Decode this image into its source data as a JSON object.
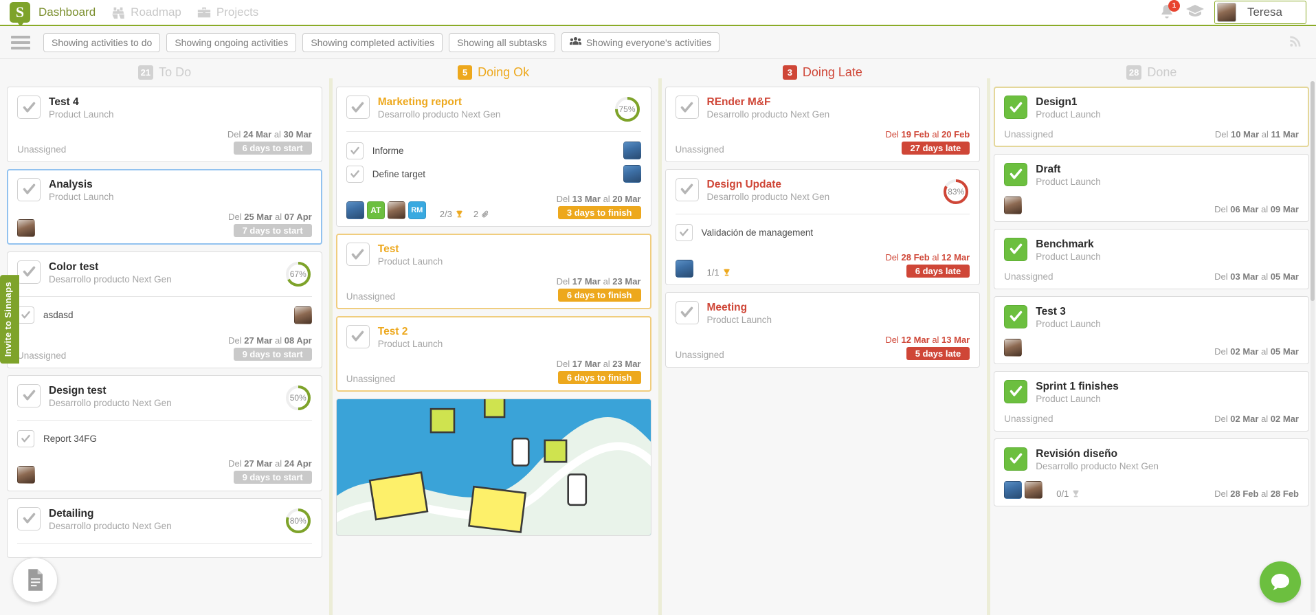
{
  "nav": {
    "logo_letter": "S",
    "items": [
      {
        "label": "Dashboard",
        "icon": "",
        "active": true
      },
      {
        "label": "Roadmap",
        "icon": "binoculars-icon",
        "active": false
      },
      {
        "label": "Projects",
        "icon": "briefcase-icon",
        "active": false
      }
    ],
    "notification_count": "1",
    "user_name": "Teresa"
  },
  "filters": {
    "chips": [
      {
        "label": "Showing activities to do",
        "icon": ""
      },
      {
        "label": "Showing ongoing activities",
        "icon": ""
      },
      {
        "label": "Showing completed activities",
        "icon": ""
      },
      {
        "label": "Showing all subtasks",
        "icon": ""
      },
      {
        "label": "Showing everyone's activities",
        "icon": "people-icon"
      }
    ]
  },
  "invite_tab": "Invite to Sinnaps",
  "columns": {
    "todo": {
      "count": "21",
      "title": "To Do"
    },
    "ok": {
      "count": "5",
      "title": "Doing Ok"
    },
    "late": {
      "count": "3",
      "title": "Doing Late"
    },
    "done": {
      "count": "28",
      "title": "Done"
    }
  },
  "todo_cards": [
    {
      "title": "Test 4",
      "project": "Product Launch",
      "assignee": "Unassigned",
      "daterange_prefix": "Del ",
      "from": "24 Mar",
      "mid": " al ",
      "to": "30 Mar",
      "pill": "6 days to start"
    },
    {
      "title": "Analysis",
      "project": "Product Launch",
      "assignee": "",
      "daterange_prefix": "Del ",
      "from": "25 Mar",
      "mid": " al ",
      "to": "07 Apr",
      "pill": "7 days to start"
    },
    {
      "title": "Color test",
      "project": "Desarrollo producto Next Gen",
      "progress": "67%",
      "subtasks": [
        {
          "label": "asdasd"
        }
      ],
      "assignee": "Unassigned",
      "daterange_prefix": "Del ",
      "from": "27 Mar",
      "mid": " al ",
      "to": "08 Apr",
      "pill": "9 days to start"
    },
    {
      "title": "Design test",
      "project": "Desarrollo producto Next Gen",
      "progress": "50%",
      "subtasks": [
        {
          "label": "Report 34FG"
        }
      ],
      "assignee": "",
      "daterange_prefix": "Del ",
      "from": "27 Mar",
      "mid": " al ",
      "to": "24 Apr",
      "pill": "9 days to start"
    },
    {
      "title": "Detailing",
      "project": "Desarrollo producto Next Gen",
      "progress": "80%"
    }
  ],
  "ok_cards": [
    {
      "title": "Marketing report",
      "project": "Desarrollo producto Next Gen",
      "progress": "75%",
      "subtasks": [
        {
          "label": "Informe"
        },
        {
          "label": "Define target"
        }
      ],
      "badges": [
        "AT",
        "RM"
      ],
      "subtask_count": "2/3",
      "attachments": "2",
      "daterange_prefix": "Del ",
      "from": "13 Mar",
      "mid": " al ",
      "to": "20 Mar",
      "pill": "3 days to finish"
    },
    {
      "title": "Test",
      "project": "Product Launch",
      "assignee": "Unassigned",
      "daterange_prefix": "Del ",
      "from": "17 Mar",
      "mid": " al ",
      "to": "23 Mar",
      "pill": "6 days to finish"
    },
    {
      "title": "Test 2",
      "project": "Product Launch",
      "assignee": "Unassigned",
      "daterange_prefix": "Del ",
      "from": "17 Mar",
      "mid": " al ",
      "to": "23 Mar",
      "pill": "6 days to finish"
    }
  ],
  "late_cards": [
    {
      "title": "REnder M&F",
      "project": "Desarrollo producto Next Gen",
      "assignee": "Unassigned",
      "daterange_prefix": "Del ",
      "from": "19 Feb",
      "mid": " al ",
      "to": "20 Feb",
      "pill": "27 days late"
    },
    {
      "title": "Design Update",
      "project": "Desarrollo producto Next Gen",
      "progress": "83%",
      "subtasks": [
        {
          "label": "Validación de management"
        }
      ],
      "subtask_count": "1/1",
      "daterange_prefix": "Del ",
      "from": "28 Feb",
      "mid": " al ",
      "to": "12 Mar",
      "pill": "6 days late"
    },
    {
      "title": "Meeting",
      "project": "Product Launch",
      "assignee": "Unassigned",
      "daterange_prefix": "Del ",
      "from": "12 Mar",
      "mid": " al ",
      "to": "13 Mar",
      "pill": "5 days late"
    }
  ],
  "done_cards": [
    {
      "title": "Design1",
      "project": "Product Launch",
      "assignee": "Unassigned",
      "daterange_prefix": "Del ",
      "from": "10 Mar",
      "mid": " al ",
      "to": "11 Mar"
    },
    {
      "title": "Draft",
      "project": "Product Launch",
      "assignee": "",
      "daterange_prefix": "Del ",
      "from": "06 Mar",
      "mid": " al ",
      "to": "09 Mar"
    },
    {
      "title": "Benchmark",
      "project": "Product Launch",
      "assignee": "Unassigned",
      "daterange_prefix": "Del ",
      "from": "03 Mar",
      "mid": " al ",
      "to": "05 Mar"
    },
    {
      "title": "Test 3",
      "project": "Product Launch",
      "assignee": "",
      "daterange_prefix": "Del ",
      "from": "02 Mar",
      "mid": " al ",
      "to": "05 Mar"
    },
    {
      "title": "Sprint 1 finishes",
      "project": "Product Launch",
      "assignee": "Unassigned",
      "daterange_prefix": "Del ",
      "from": "02 Mar",
      "mid": " al ",
      "to": "02 Mar"
    },
    {
      "title": "Revisión diseño",
      "project": "Desarrollo producto Next Gen",
      "subtask_count": "0/1",
      "daterange_prefix": "Del ",
      "from": "28 Feb",
      "mid": " al ",
      "to": "28 Feb"
    }
  ],
  "colors": {
    "brand_green": "#7ea32a",
    "ok_orange": "#eda81d",
    "late_red": "#cf4637",
    "done_green": "#6cbf3f",
    "muted": "#cdcdcd"
  }
}
